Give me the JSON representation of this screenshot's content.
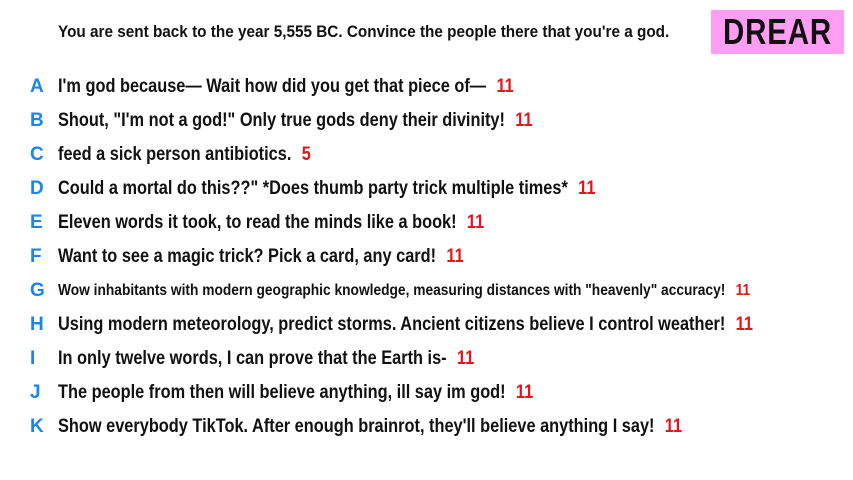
{
  "prompt": "You are sent back to the year 5,555 BC. Convince the people there that you're a god.",
  "brand": {
    "label": "DREAR",
    "bg_color": "#ff9ef4"
  },
  "colors": {
    "letter": "#1a86e8",
    "score": "#e4151b",
    "text": "#111111"
  },
  "answers": [
    {
      "letter": "A",
      "text": "I'm god because— Wait how did you get that piece of—",
      "score": "11"
    },
    {
      "letter": "B",
      "text": "Shout, \"I'm not a god!\" Only true gods deny their divinity!",
      "score": "11"
    },
    {
      "letter": "C",
      "text": "feed a sick person antibiotics.",
      "score": "5"
    },
    {
      "letter": "D",
      "text": "Could a mortal do this??\" *Does thumb party trick multiple times*",
      "score": "11"
    },
    {
      "letter": "E",
      "text": "Eleven words it took, to read the minds like a book!",
      "score": "11"
    },
    {
      "letter": "F",
      "text": "Want to see a magic trick? Pick a card, any card!",
      "score": "11"
    },
    {
      "letter": "G",
      "text": "Wow inhabitants with modern geographic knowledge, measuring distances with \"heavenly\" accuracy!",
      "score": "11"
    },
    {
      "letter": "H",
      "text": "Using modern meteorology, predict storms. Ancient citizens believe I control weather!",
      "score": "11"
    },
    {
      "letter": "I",
      "text": "In only twelve words, I can prove that the Earth is-",
      "score": "11"
    },
    {
      "letter": "J",
      "text": "The people from then will believe anything, ill say im god!",
      "score": "11"
    },
    {
      "letter": "K",
      "text": "Show everybody TikTok. After enough brainrot, they'll believe anything I say!",
      "score": "11"
    }
  ]
}
